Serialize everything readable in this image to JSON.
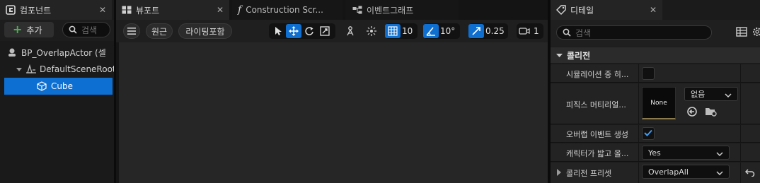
{
  "left_panel": {
    "tab_title": "컴포넌트",
    "add_label": "추가",
    "search_placeholder": "검색",
    "tree": [
      {
        "label": "BP_OverlapActor (셀",
        "icon": "actor-icon"
      },
      {
        "label": "DefaultSceneRoot",
        "icon": "scene-root-icon"
      },
      {
        "label": "Cube",
        "icon": "cube-icon",
        "selected": true
      }
    ]
  },
  "center_tabs": [
    {
      "label": "뷰포트",
      "icon": "viewport-icon",
      "active": true
    },
    {
      "label": "Construction Scr...",
      "icon": "function-icon",
      "active": false
    },
    {
      "label": "이벤트그래프",
      "icon": "event-graph-icon",
      "active": false
    }
  ],
  "viewport_toolbar": {
    "perspective_label": "원근",
    "lighting_label": "라이팅포함",
    "grid_snap_value": "10",
    "rotation_snap_value": "10°",
    "scale_snap_value": "0.25",
    "camera_speed_value": "1"
  },
  "details_panel": {
    "tab_title": "디테일",
    "search_placeholder": "검색",
    "category": "콜리전",
    "properties": {
      "simulation_generates_hit": {
        "label": "시뮬레이션 중 히...",
        "checked": false
      },
      "phys_material": {
        "label": "피직스 머티리얼...",
        "thumb_text": "None",
        "dropdown_value": "없음"
      },
      "overlap_events": {
        "label": "오버랩 이벤트 생성",
        "checked": true
      },
      "can_character_step": {
        "label": "캐릭터가 밟고 올...",
        "dropdown_value": "Yes"
      },
      "collision_presets": {
        "label": "콜리전 프리셋",
        "dropdown_value": "OverlapAll"
      }
    }
  },
  "colors": {
    "accent": "#0f6fd1",
    "selection": "#0d6fd2",
    "add_green": "#4caf50"
  }
}
